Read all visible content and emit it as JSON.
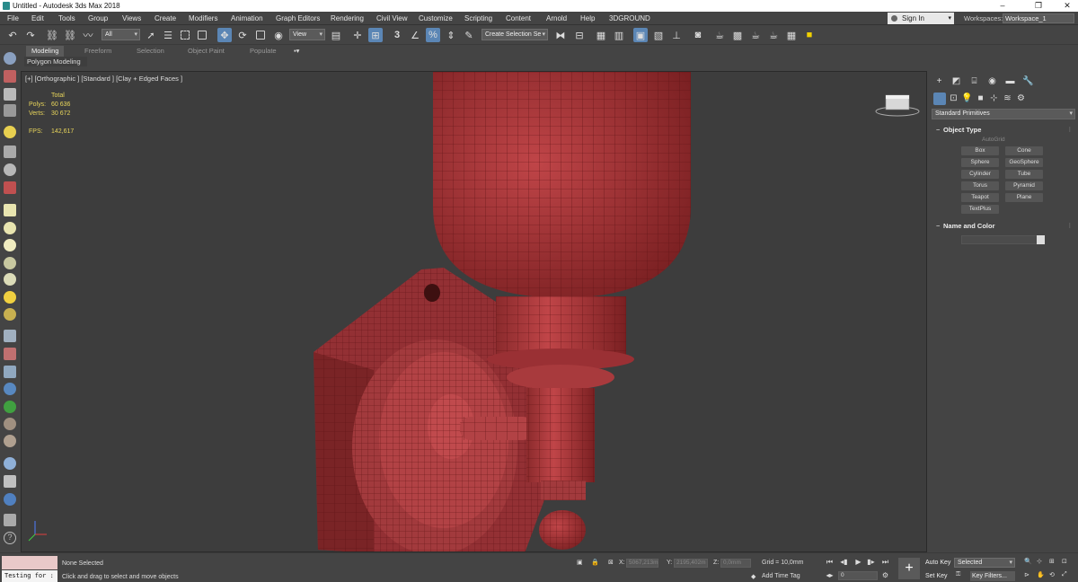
{
  "window": {
    "title": "Untitled - Autodesk 3ds Max 2018",
    "controls": [
      "–",
      "❐",
      "✕"
    ]
  },
  "menu": [
    "File",
    "Edit",
    "Tools",
    "Group",
    "Views",
    "Create",
    "Modifiers",
    "Animation",
    "Graph Editors",
    "Rendering",
    "Civil View",
    "Customize",
    "Scripting",
    "Content",
    "Arnold",
    "Help",
    "3DGROUND"
  ],
  "account": {
    "sign_in": "Sign In",
    "workspaces_label": "Workspaces:",
    "workspace": "Workspace_1"
  },
  "toolbar": {
    "filter": "All",
    "ref_coord": "View",
    "selection_set": "Create Selection Se",
    "snap_label": "3"
  },
  "ribbon": {
    "tabs": [
      "Modeling",
      "Freeform",
      "Selection",
      "Object Paint",
      "Populate"
    ],
    "active": "Modeling",
    "panel": "Polygon Modeling"
  },
  "viewport": {
    "label": "[+] [Orthographic ] [Standard ] [Clay + Edged Faces ]",
    "stats": {
      "total_label": "Total",
      "polys_label": "Polys:",
      "polys": "60 636",
      "verts_label": "Verts:",
      "verts": "30 672",
      "fps_label": "FPS:",
      "fps": "142,617"
    },
    "colors": {
      "model": "#a8383a",
      "wire": "#5c1214",
      "background": "#3d3d3d"
    }
  },
  "command_panel": {
    "category": "Standard Primitives",
    "object_type": {
      "title": "Object Type",
      "autogrid": "AutoGrid",
      "buttons": [
        "Box",
        "Cone",
        "Sphere",
        "GeoSphere",
        "Cylinder",
        "Tube",
        "Torus",
        "Pyramid",
        "Teapot",
        "Plane",
        "TextPlus"
      ]
    },
    "name_color": {
      "title": "Name and Color"
    }
  },
  "status": {
    "maxscript": "Testing for :",
    "selection": "None Selected",
    "prompt": "Click and drag to select and move objects",
    "x_label": "X:",
    "x": "5067,213m",
    "y_label": "Y:",
    "y": "2195,402m",
    "z_label": "Z:",
    "z": "0,0mm",
    "grid": "Grid = 10,0mm",
    "add_time_tag": "Add Time Tag",
    "auto_key": "Auto Key",
    "set_key": "Set Key",
    "key_mode": "Selected",
    "key_filters": "Key Filters...",
    "frame": "0"
  }
}
